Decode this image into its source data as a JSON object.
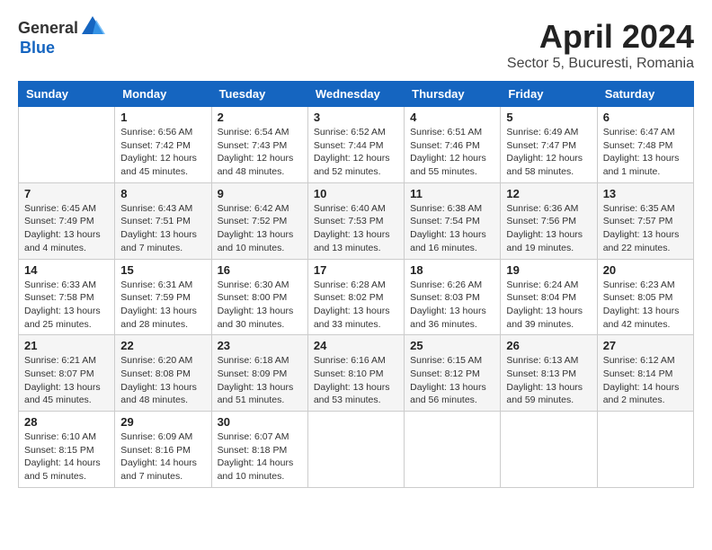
{
  "header": {
    "logo_general": "General",
    "logo_blue": "Blue",
    "month": "April 2024",
    "location": "Sector 5, Bucuresti, Romania"
  },
  "days_of_week": [
    "Sunday",
    "Monday",
    "Tuesday",
    "Wednesday",
    "Thursday",
    "Friday",
    "Saturday"
  ],
  "weeks": [
    [
      {
        "day": "",
        "info": ""
      },
      {
        "day": "1",
        "info": "Sunrise: 6:56 AM\nSunset: 7:42 PM\nDaylight: 12 hours\nand 45 minutes."
      },
      {
        "day": "2",
        "info": "Sunrise: 6:54 AM\nSunset: 7:43 PM\nDaylight: 12 hours\nand 48 minutes."
      },
      {
        "day": "3",
        "info": "Sunrise: 6:52 AM\nSunset: 7:44 PM\nDaylight: 12 hours\nand 52 minutes."
      },
      {
        "day": "4",
        "info": "Sunrise: 6:51 AM\nSunset: 7:46 PM\nDaylight: 12 hours\nand 55 minutes."
      },
      {
        "day": "5",
        "info": "Sunrise: 6:49 AM\nSunset: 7:47 PM\nDaylight: 12 hours\nand 58 minutes."
      },
      {
        "day": "6",
        "info": "Sunrise: 6:47 AM\nSunset: 7:48 PM\nDaylight: 13 hours\nand 1 minute."
      }
    ],
    [
      {
        "day": "7",
        "info": "Sunrise: 6:45 AM\nSunset: 7:49 PM\nDaylight: 13 hours\nand 4 minutes."
      },
      {
        "day": "8",
        "info": "Sunrise: 6:43 AM\nSunset: 7:51 PM\nDaylight: 13 hours\nand 7 minutes."
      },
      {
        "day": "9",
        "info": "Sunrise: 6:42 AM\nSunset: 7:52 PM\nDaylight: 13 hours\nand 10 minutes."
      },
      {
        "day": "10",
        "info": "Sunrise: 6:40 AM\nSunset: 7:53 PM\nDaylight: 13 hours\nand 13 minutes."
      },
      {
        "day": "11",
        "info": "Sunrise: 6:38 AM\nSunset: 7:54 PM\nDaylight: 13 hours\nand 16 minutes."
      },
      {
        "day": "12",
        "info": "Sunrise: 6:36 AM\nSunset: 7:56 PM\nDaylight: 13 hours\nand 19 minutes."
      },
      {
        "day": "13",
        "info": "Sunrise: 6:35 AM\nSunset: 7:57 PM\nDaylight: 13 hours\nand 22 minutes."
      }
    ],
    [
      {
        "day": "14",
        "info": "Sunrise: 6:33 AM\nSunset: 7:58 PM\nDaylight: 13 hours\nand 25 minutes."
      },
      {
        "day": "15",
        "info": "Sunrise: 6:31 AM\nSunset: 7:59 PM\nDaylight: 13 hours\nand 28 minutes."
      },
      {
        "day": "16",
        "info": "Sunrise: 6:30 AM\nSunset: 8:00 PM\nDaylight: 13 hours\nand 30 minutes."
      },
      {
        "day": "17",
        "info": "Sunrise: 6:28 AM\nSunset: 8:02 PM\nDaylight: 13 hours\nand 33 minutes."
      },
      {
        "day": "18",
        "info": "Sunrise: 6:26 AM\nSunset: 8:03 PM\nDaylight: 13 hours\nand 36 minutes."
      },
      {
        "day": "19",
        "info": "Sunrise: 6:24 AM\nSunset: 8:04 PM\nDaylight: 13 hours\nand 39 minutes."
      },
      {
        "day": "20",
        "info": "Sunrise: 6:23 AM\nSunset: 8:05 PM\nDaylight: 13 hours\nand 42 minutes."
      }
    ],
    [
      {
        "day": "21",
        "info": "Sunrise: 6:21 AM\nSunset: 8:07 PM\nDaylight: 13 hours\nand 45 minutes."
      },
      {
        "day": "22",
        "info": "Sunrise: 6:20 AM\nSunset: 8:08 PM\nDaylight: 13 hours\nand 48 minutes."
      },
      {
        "day": "23",
        "info": "Sunrise: 6:18 AM\nSunset: 8:09 PM\nDaylight: 13 hours\nand 51 minutes."
      },
      {
        "day": "24",
        "info": "Sunrise: 6:16 AM\nSunset: 8:10 PM\nDaylight: 13 hours\nand 53 minutes."
      },
      {
        "day": "25",
        "info": "Sunrise: 6:15 AM\nSunset: 8:12 PM\nDaylight: 13 hours\nand 56 minutes."
      },
      {
        "day": "26",
        "info": "Sunrise: 6:13 AM\nSunset: 8:13 PM\nDaylight: 13 hours\nand 59 minutes."
      },
      {
        "day": "27",
        "info": "Sunrise: 6:12 AM\nSunset: 8:14 PM\nDaylight: 14 hours\nand 2 minutes."
      }
    ],
    [
      {
        "day": "28",
        "info": "Sunrise: 6:10 AM\nSunset: 8:15 PM\nDaylight: 14 hours\nand 5 minutes."
      },
      {
        "day": "29",
        "info": "Sunrise: 6:09 AM\nSunset: 8:16 PM\nDaylight: 14 hours\nand 7 minutes."
      },
      {
        "day": "30",
        "info": "Sunrise: 6:07 AM\nSunset: 8:18 PM\nDaylight: 14 hours\nand 10 minutes."
      },
      {
        "day": "",
        "info": ""
      },
      {
        "day": "",
        "info": ""
      },
      {
        "day": "",
        "info": ""
      },
      {
        "day": "",
        "info": ""
      }
    ]
  ]
}
